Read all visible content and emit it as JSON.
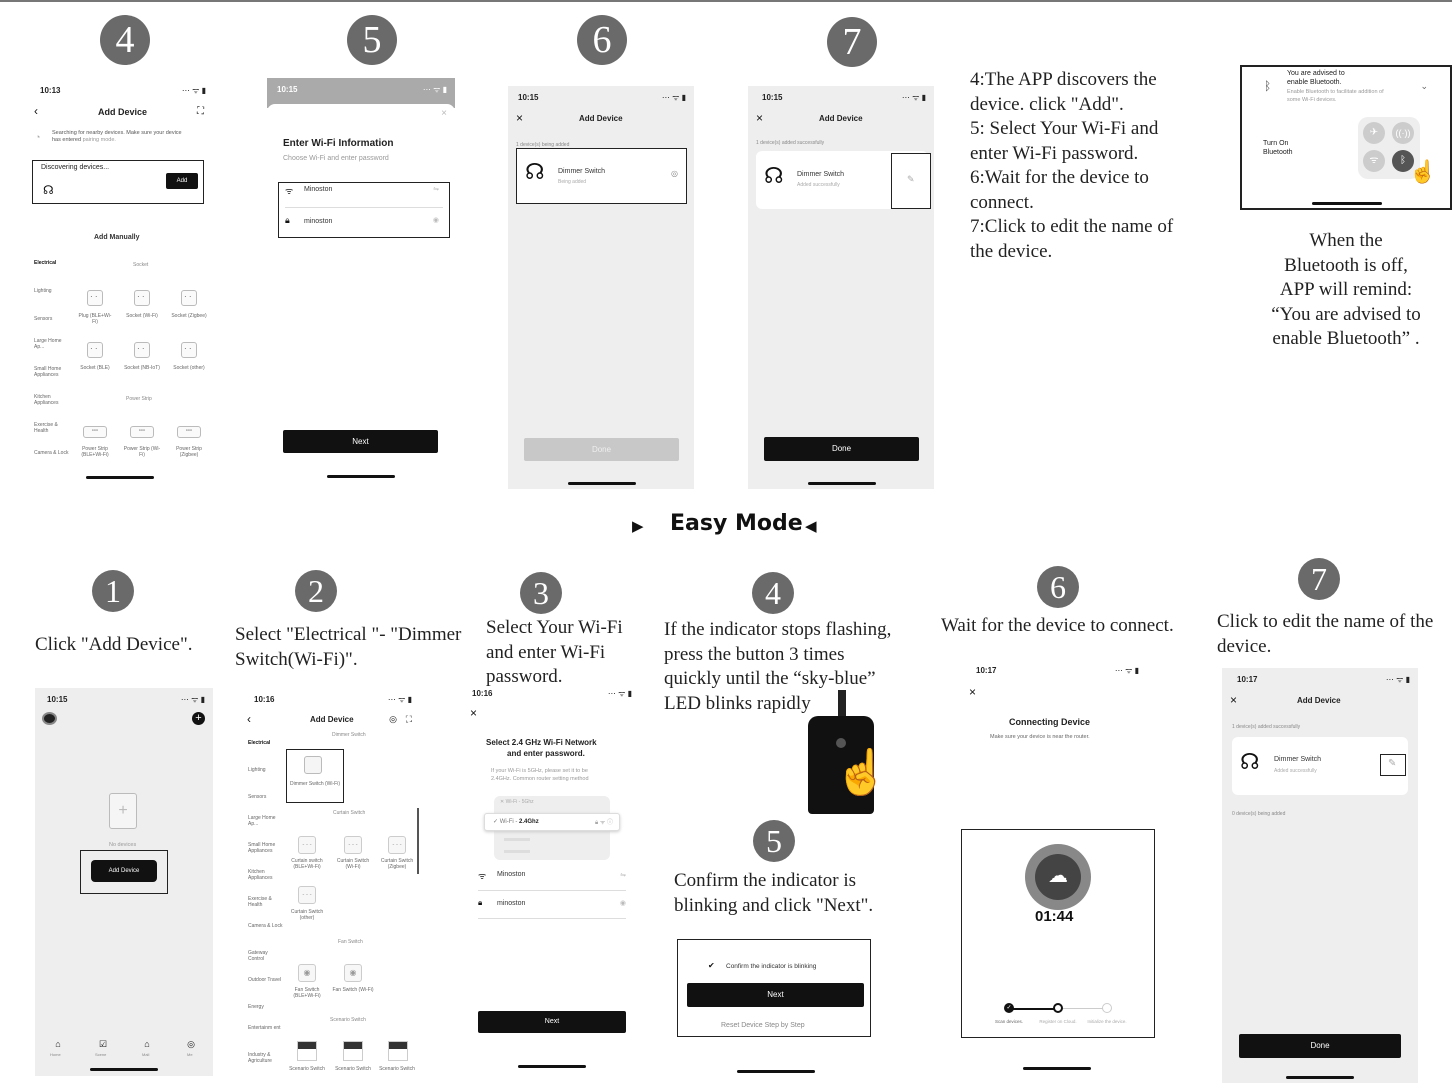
{
  "step_numbers": {
    "top": [
      "4",
      "5",
      "6",
      "7"
    ],
    "bottom": [
      "1",
      "2",
      "3",
      "4",
      "5",
      "6",
      "7"
    ]
  },
  "top_instructions": [
    "4:The APP discovers the device. click \"Add\".",
    "5: Select Your Wi-Fi and enter Wi-Fi password.",
    "6:Wait for the device to connect.",
    "7:Click to edit the name of the device."
  ],
  "bluetooth_note": [
    "When the",
    "Bluetooth is off,",
    "APP will remind:",
    "“You are advised to",
    "enable Bluetooth” ."
  ],
  "bluetooth_panel": {
    "title_line1": "You are advised to",
    "title_line2": "enable Bluetooth.",
    "subtitle_line1": "Enable Bluetooth to facilitate addition of",
    "subtitle_line2": "some Wi-Fi devices.",
    "turn_on_line1": "Turn On",
    "turn_on_line2": "Bluetooth"
  },
  "mode_title": "Easy Mode",
  "bottom_captions": {
    "s1": "Click \"Add Device\".",
    "s2_line1": "Select \"Electrical \"- \"Dimmer",
    "s2_line2": "Switch(Wi-Fi)\".",
    "s3_line1": "Select Your Wi-Fi",
    "s3_line2": "and enter Wi-Fi",
    "s3_line3": "password.",
    "s4_line1": "If the indicator stops flashing,",
    "s4_line2": "press the button 3 times",
    "s4_line3": "quickly until the “sky-blue”",
    "s4_line4": "LED blinks rapidly",
    "s5_line1": "Confirm the indicator is",
    "s5_line2": "blinking and click \"Next\".",
    "s6": "Wait for the device to connect.",
    "s7_line1": "Click to edit the name of the",
    "s7_line2": "device."
  },
  "screen4": {
    "time": "10:13",
    "title": "Add Device",
    "searching_line1": "Searching for nearby devices. Make sure your device",
    "searching_line2a": "has entered ",
    "searching_line2b": "pairing mode.",
    "discovering": "Discovering devices...",
    "add": "Add",
    "add_manually": "Add Manually",
    "categories": [
      "Electrical",
      "Lighting",
      "Sensors",
      "Large Home Ap...",
      "Small Home Appliances",
      "Kitchen Appliances",
      "Exercise & Health",
      "Camera & Lock"
    ],
    "socket_header": "Socket",
    "row1": [
      "Plug (BLE+Wi-Fi)",
      "Socket (Wi-Fi)",
      "Socket (Zigbee)"
    ],
    "row2": [
      "Socket (BLE)",
      "Socket (NB-IoT)",
      "Socket (other)"
    ],
    "power_strip_header": "Power Strip",
    "row3": [
      "Power Strip (BLE+Wi-Fi)",
      "Power Strip (Wi-Fi)",
      "Power Strip (Zigbee)"
    ]
  },
  "screen5": {
    "time": "10:15",
    "title": "Enter Wi-Fi Information",
    "subtitle": "Choose Wi-Fi and enter password",
    "ssid": "Minoston",
    "password": "minoston",
    "next": "Next"
  },
  "screen6": {
    "time": "10:15",
    "title": "Add Device",
    "status": "1 device(s) being added",
    "device": "Dimmer Switch",
    "device_status": "Being added",
    "done": "Done"
  },
  "screen7": {
    "time": "10:15",
    "title": "Add Device",
    "status": "1 device(s) added successfully",
    "device": "Dimmer Switch",
    "device_status": "Added successfully",
    "done": "Done"
  },
  "screen_b1": {
    "time": "10:15",
    "no_devices": "No devices",
    "add_device": "Add Device",
    "tabs": [
      "Home",
      "Scene",
      "Mall",
      "Me"
    ]
  },
  "screen_b2": {
    "time": "10:16",
    "title": "Add Device",
    "categories": [
      "Electrical",
      "Lighting",
      "Sensors",
      "Large Home Ap...",
      "Small Home Appliances",
      "Kitchen Appliances",
      "Exercise & Health",
      "Camera & Lock",
      "Gateway Control",
      "Outdoor Travel",
      "Energy",
      "Entertainm ent",
      "Industry & Agriculture"
    ],
    "dimmer_header": "Dimmer Switch",
    "dimmer_item": "Dimmer Switch (Wi-Fi)",
    "curtain_header": "Curtain Switch",
    "curtain_items": [
      "Curtain switch (BLE+Wi-Fi)",
      "Curtain Switch (Wi-Fi)",
      "Curtain Switch (Zigbee)",
      "Curtain Switch (other)"
    ],
    "fan_header": "Fan Switch",
    "fan_items": [
      "Fan Switch (BLE+Wi-Fi)",
      "Fan Switch (Wi-Fi)"
    ],
    "scenario_header": "Scenario Switch",
    "scenario_items": [
      "Scenario Switch",
      "Scenario Switch",
      "Scenario Switch"
    ]
  },
  "screen_b3": {
    "time": "10:16",
    "title_line1": "Select 2.4 GHz Wi-Fi Network",
    "title_line2": "and enter password.",
    "note_line1": "If your Wi-Fi is 5GHz, please set it to be",
    "note_line2": "2.4GHz. Common router setting method",
    "wifi_5g": "Wi-Fi - 5Ghz",
    "wifi_24_prefix": "Wi-Fi - ",
    "wifi_24": "2.4Ghz",
    "ssid": "Minoston",
    "password": "minoston",
    "next": "Next"
  },
  "screen_b5": {
    "confirm": "Confirm the indicator is blinking",
    "next": "Next",
    "reset": "Reset Device Step by Step"
  },
  "screen_b6": {
    "time": "10:17",
    "title": "Connecting Device",
    "subtitle": "Make sure your device is near the router.",
    "countdown": "01:44",
    "steps": [
      "Scan devices.",
      "Register on Cloud.",
      "Initialize the device."
    ]
  },
  "screen_b7": {
    "time": "10:17",
    "title": "Add Device",
    "status_added": "1 device(s) added successfully",
    "device": "Dimmer Switch",
    "device_status": "Added successfully",
    "status_adding": "0 device(s) being added",
    "done": "Done"
  }
}
